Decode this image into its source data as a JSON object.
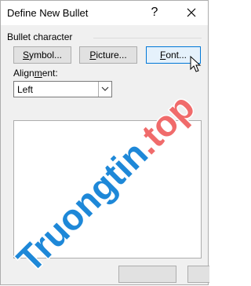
{
  "window": {
    "title": "Define New Bullet",
    "help_glyph": "?",
    "close_icon": "close-icon"
  },
  "bullet_character": {
    "section_label": "Bullet character",
    "symbol_button": {
      "accel": "S",
      "rest": "ymbol..."
    },
    "picture_button": {
      "accel": "P",
      "rest": "icture..."
    },
    "font_button": {
      "accel": "F",
      "rest": "ont..."
    }
  },
  "alignment": {
    "label_accel": "m",
    "label_before": "Align",
    "label_after": "ent:",
    "selected": "Left"
  },
  "watermark": {
    "text": "Truongtin.top",
    "colors": {
      "main": "#1e88d8",
      "accent": "#f06b6b"
    }
  },
  "colors": {
    "focus_border": "#0078d7",
    "focus_fill": "#e5f1fb"
  }
}
